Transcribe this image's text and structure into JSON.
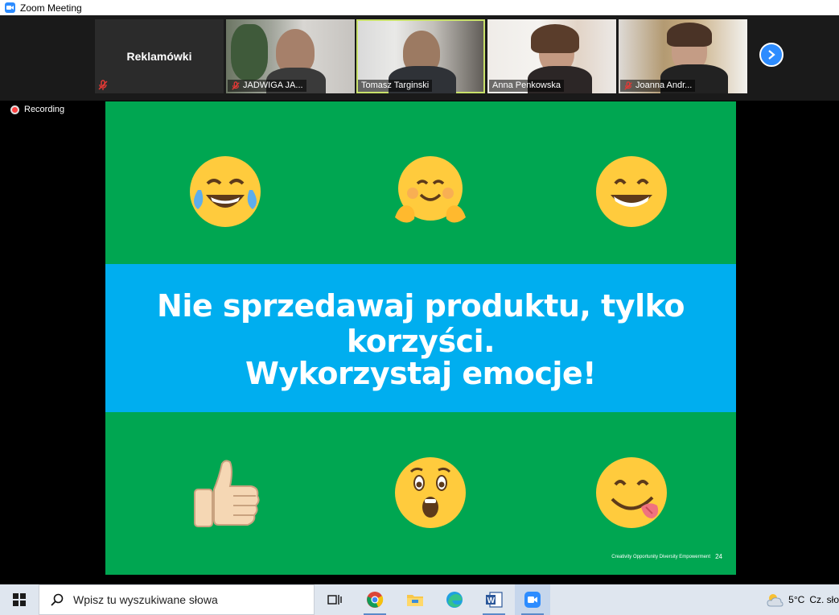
{
  "window": {
    "title": "Zoom Meeting"
  },
  "gallery": {
    "self_name": "Reklamówki",
    "participants": [
      {
        "name": "JADWIGA JA...",
        "muted": true
      },
      {
        "name": "Tomasz Targinski",
        "muted": false,
        "active_speaker": true
      },
      {
        "name": "Anna Penkowska",
        "muted": false
      },
      {
        "name": "Joanna Andr...",
        "muted": true
      }
    ]
  },
  "recording": {
    "label": "Recording"
  },
  "slide": {
    "line1": "Nie sprzedawaj produktu, tylko korzyści.",
    "line2": "Wykorzystaj emocje!",
    "footer": "Creativity Opportunity Diversity Empowerment",
    "page_number": "24",
    "emojis": [
      "tears-of-joy-emoji",
      "hugging-face-emoji",
      "grinning-face-emoji",
      "thumbs-up-emoji",
      "astonished-face-emoji",
      "face-savoring-food-emoji"
    ],
    "colors": {
      "background": "#00a651",
      "band": "#00aeef"
    }
  },
  "taskbar": {
    "search_placeholder": "Wpisz tu wyszukiwane słowa",
    "apps": [
      "task-view-icon",
      "chrome-icon",
      "file-explorer-icon",
      "edge-icon",
      "word-icon",
      "zoom-icon"
    ],
    "weather": {
      "temperature": "5°C",
      "condition": "Cz. sło"
    }
  }
}
